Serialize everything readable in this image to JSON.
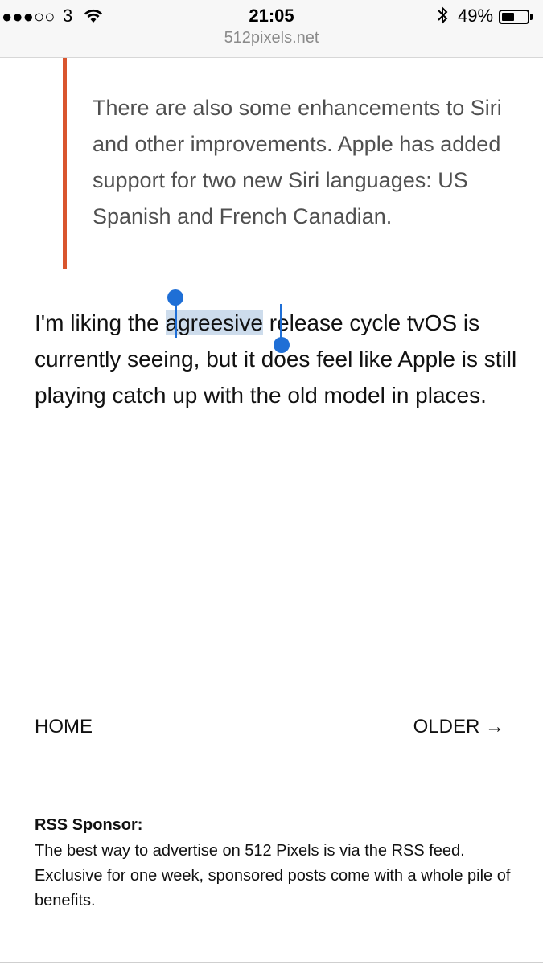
{
  "status_bar": {
    "signal_dots": "●●●○○",
    "carrier": "3",
    "time": "21:05",
    "battery_percent": "49%",
    "battery_level": 0.49
  },
  "browser": {
    "domain": "512pixels.net"
  },
  "article": {
    "blockquote": "There are also some enhancements to Siri and other improvements. Apple has added support for two new Siri languages: US Spanish and French Canadian.",
    "paragraph_before": "I'm liking the ",
    "paragraph_selected": "agreesive",
    "paragraph_after": " release cycle tvOS is currently seeing, but it does feel like Apple is still playing catch up with the old model in places."
  },
  "navigation": {
    "home_label": "HOME",
    "older_label": "OLDER →"
  },
  "sponsor": {
    "title": "RSS Sponsor:",
    "text": "The best way to advertise on 512 Pixels is via the RSS feed. Exclusive for one week, sponsored posts come with a whole pile of benefits."
  },
  "colors": {
    "accent_bar": "#d9552e",
    "selection_handle": "#1f6fd6",
    "selection_highlight": "#cddcec"
  }
}
